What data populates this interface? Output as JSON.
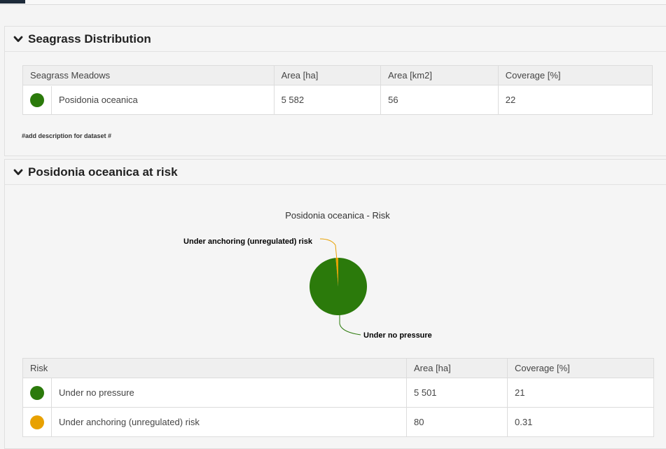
{
  "panels": {
    "distribution": {
      "title": "Seagrass Distribution",
      "table": {
        "headers": [
          "Seagrass Meadows",
          "Area [ha]",
          "Area [km2]",
          "Coverage [%]"
        ],
        "rows": [
          {
            "color": "#2b7a0b",
            "name": "Posidonia oceanica",
            "area_ha": "5 582",
            "area_km2": "56",
            "coverage": "22"
          }
        ]
      },
      "description": "#add description for dataset #"
    },
    "risk": {
      "title": "Posidonia oceanica at risk",
      "table": {
        "headers": [
          "Risk",
          "Area [ha]",
          "Coverage [%]"
        ],
        "rows": [
          {
            "color": "#2b7a0b",
            "name": "Under no pressure",
            "area_ha": "5 501",
            "coverage": "21"
          },
          {
            "color": "#e8a100",
            "name": "Under anchoring (unregulated) risk",
            "area_ha": "80",
            "coverage": "0.31"
          }
        ]
      }
    }
  },
  "chart_data": {
    "type": "pie",
    "title": "Posidonia oceanica - Risk",
    "slices": [
      {
        "label": "Under no pressure",
        "value": 5501,
        "color": "#2b7a0b"
      },
      {
        "label": "Under anchoring (unregulated) risk",
        "value": 80,
        "color": "#e8a100"
      }
    ]
  }
}
